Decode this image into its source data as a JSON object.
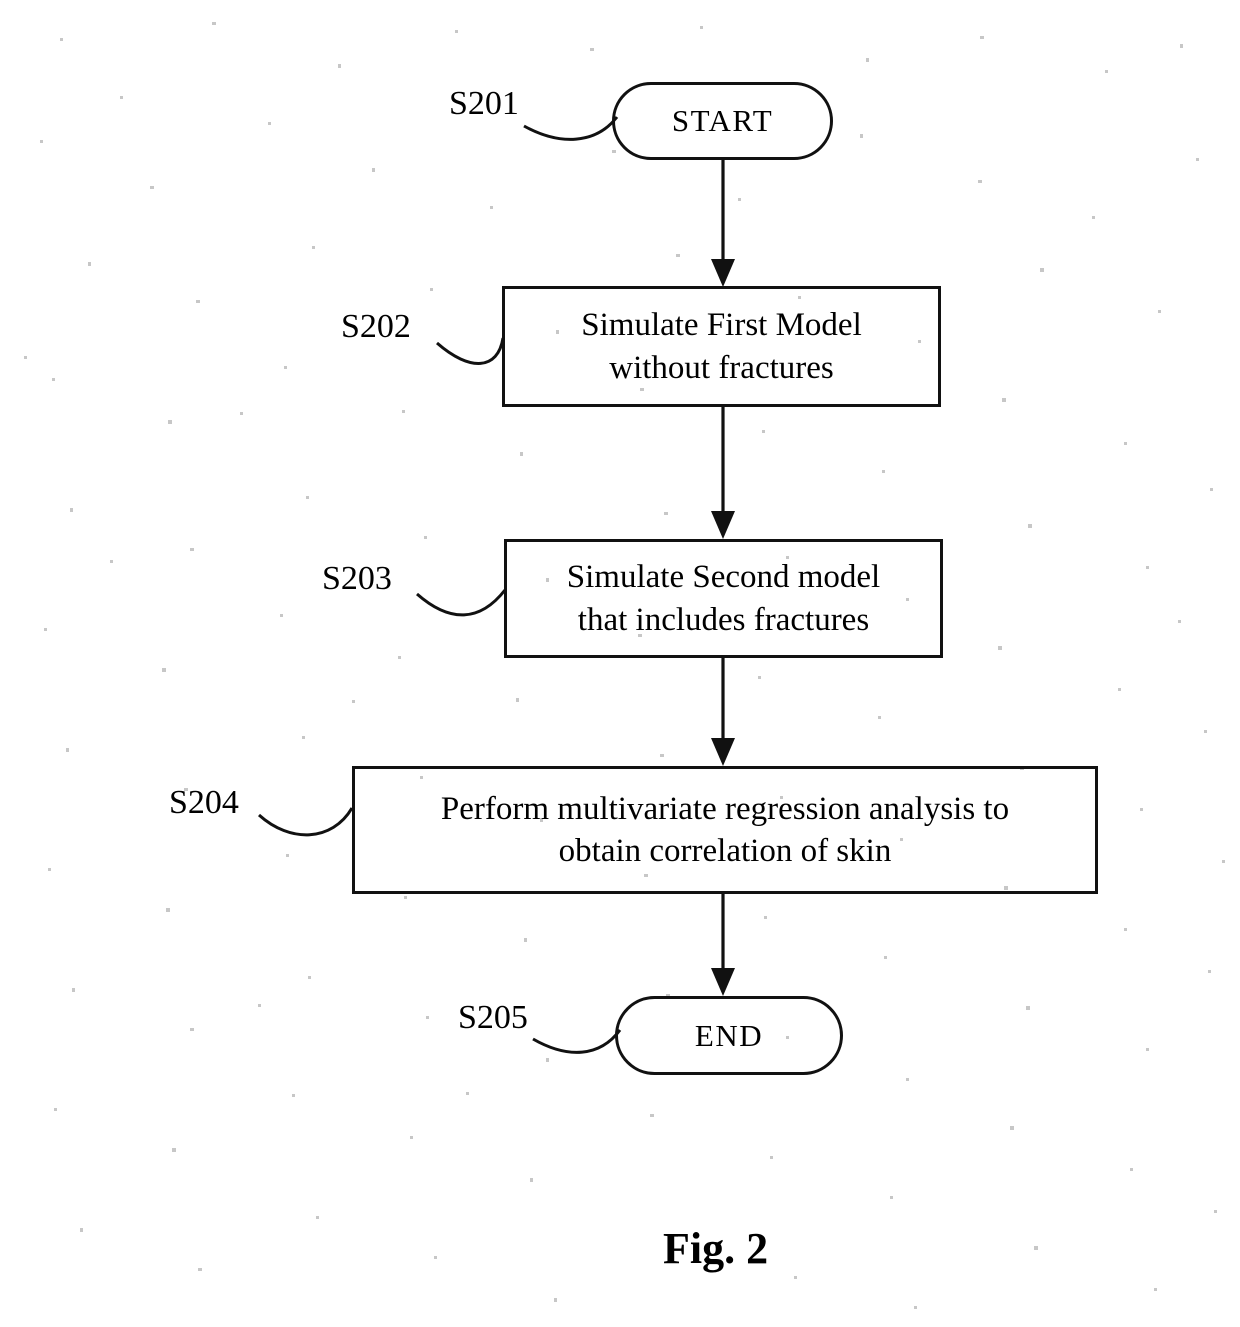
{
  "figure": {
    "caption": "Fig. 2",
    "type": "process-flowchart"
  },
  "nodes": [
    {
      "id": "start",
      "shape": "terminal",
      "text": "START",
      "step_label": "S201"
    },
    {
      "id": "s202",
      "shape": "process",
      "text_line1": "Simulate First Model",
      "text_line2": "without fractures",
      "step_label": "S202"
    },
    {
      "id": "s203",
      "shape": "process",
      "text_line1": "Simulate Second model",
      "text_line2": "that includes fractures",
      "step_label": "S203"
    },
    {
      "id": "s204",
      "shape": "process",
      "text_line1": "Perform multivariate regression analysis to",
      "text_line2": "obtain correlation of skin",
      "step_label": "S204"
    },
    {
      "id": "end",
      "shape": "terminal",
      "text": "END",
      "step_label": "S205"
    }
  ],
  "labels": {
    "s201": "S201",
    "s202": "S202",
    "s203": "S203",
    "s204": "S204",
    "s205": "S205"
  },
  "node_text": {
    "start": "START",
    "end": "END",
    "s202_l1": "Simulate First Model",
    "s202_l2": "without fractures",
    "s203_l1": "Simulate Second model",
    "s203_l2": "that includes fractures",
    "s204_l1": "Perform multivariate regression analysis to",
    "s204_l2": "obtain correlation of skin"
  },
  "colors": {
    "stroke": "#111111",
    "text": "#000000",
    "background": "#ffffff"
  }
}
